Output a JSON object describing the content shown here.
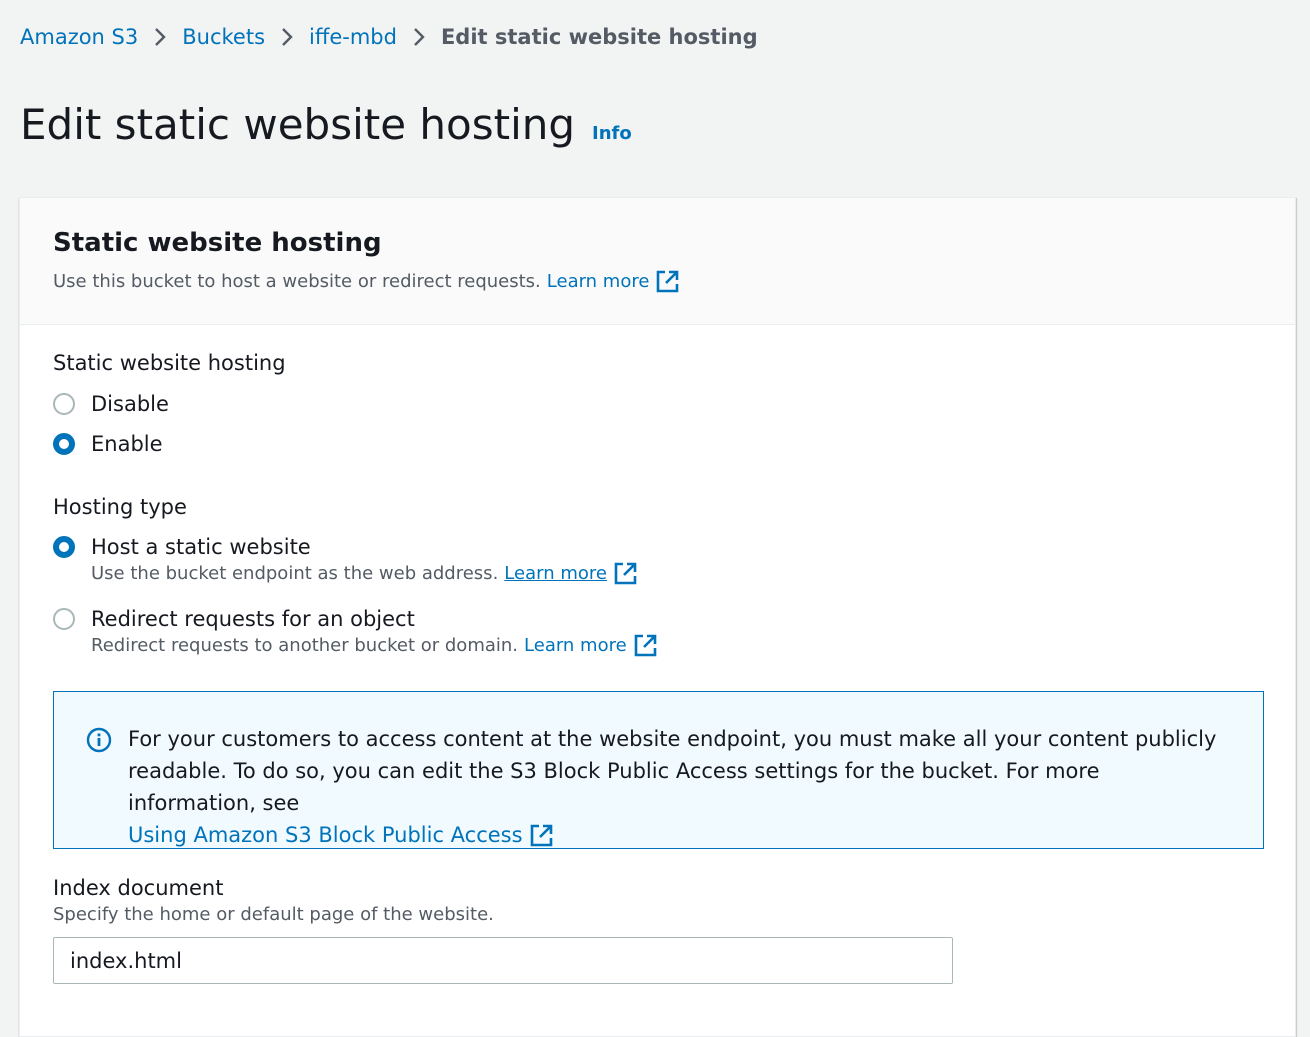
{
  "breadcrumb": {
    "items": [
      "Amazon S3",
      "Buckets",
      "iffe-mbd"
    ],
    "current": "Edit static website hosting"
  },
  "page": {
    "title": "Edit static website hosting",
    "info_link": "Info"
  },
  "panel": {
    "title": "Static website hosting",
    "description": "Use this bucket to host a website or redirect requests.",
    "learn_more": "Learn more"
  },
  "hosting": {
    "label": "Static website hosting",
    "options": [
      "Disable",
      "Enable"
    ],
    "selected": "Enable"
  },
  "hosting_type": {
    "label": "Hosting type",
    "options": [
      {
        "label": "Host a static website",
        "description": "Use the bucket endpoint as the web address.",
        "learn_more": "Learn more",
        "selected": true
      },
      {
        "label": "Redirect requests for an object",
        "description": "Redirect requests to another bucket or domain.",
        "learn_more": "Learn more",
        "selected": false
      }
    ]
  },
  "alert": {
    "text": "For your customers to access content at the website endpoint, you must make all your content publicly readable. To do so, you can edit the S3 Block Public Access settings for the bucket. For more information, see",
    "link": "Using Amazon S3 Block Public Access"
  },
  "index_document": {
    "label": "Index document",
    "description": "Specify the home or default page of the website.",
    "value": "index.html"
  },
  "colors": {
    "link": "#0073bb",
    "background": "#f2f3f3",
    "alert_bg": "#f1faff"
  }
}
